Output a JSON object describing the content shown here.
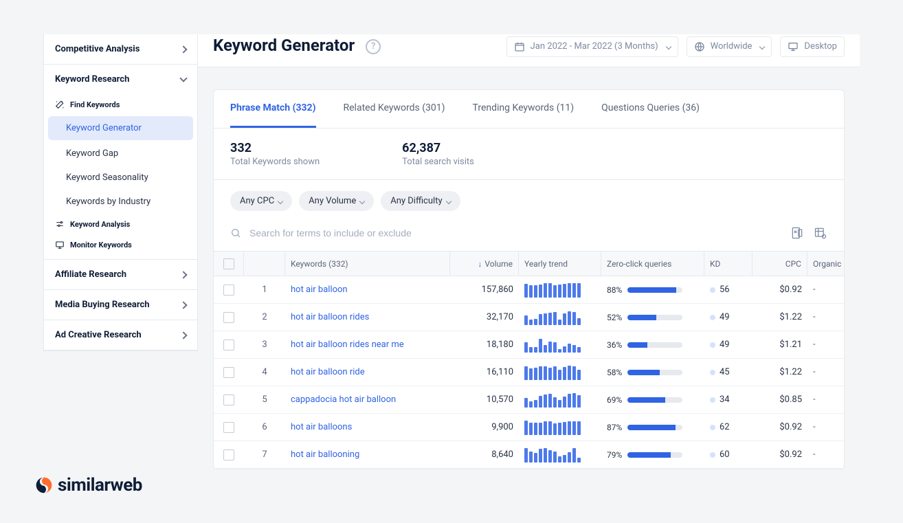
{
  "page_title": "Keyword Generator",
  "topbar": {
    "date_range": "Jan 2022 - Mar 2022 (3 Months)",
    "scope": "Worldwide",
    "device": "Desktop"
  },
  "sidebar": {
    "sections": [
      {
        "label": "Competitive Analysis"
      },
      {
        "label": "Keyword Research"
      }
    ],
    "group_find": "Find Keywords",
    "find_items": [
      {
        "label": "Keyword Generator",
        "active": true
      },
      {
        "label": "Keyword Gap"
      },
      {
        "label": "Keyword Seasonality"
      },
      {
        "label": "Keywords by Industry"
      }
    ],
    "group_analysis": "Keyword Analysis",
    "group_monitor": "Monitor Keywords",
    "bottom_sections": [
      {
        "label": "Affiliate Research"
      },
      {
        "label": "Media Buying Research"
      },
      {
        "label": "Ad Creative Research"
      }
    ]
  },
  "tabs": [
    {
      "label": "Phrase Match (332)",
      "active": true
    },
    {
      "label": "Related Keywords (301)"
    },
    {
      "label": "Trending Keywords (11)"
    },
    {
      "label": "Questions Queries (36)"
    }
  ],
  "stats": {
    "total_keywords": {
      "value": "332",
      "label": "Total Keywords shown"
    },
    "total_visits": {
      "value": "62,387",
      "label": "Total search visits"
    }
  },
  "filters": [
    "Any CPC",
    "Any Volume",
    "Any Difficulty"
  ],
  "search_placeholder": "Search for terms to include or exclude",
  "columns": {
    "keywords": "Keywords (332)",
    "volume": "Volume",
    "trend": "Yearly trend",
    "zeroclick": "Zero-click queries",
    "kd": "KD",
    "cpc": "CPC",
    "organic": "Organic"
  },
  "rows": [
    {
      "idx": 1,
      "kw": "hot air balloon",
      "vol": "157,860",
      "trend": [
        90,
        80,
        80,
        85,
        95,
        95,
        80,
        85,
        90,
        95,
        95,
        95
      ],
      "zc_pct": 88,
      "kd": 56,
      "cpc": "$0.92",
      "org": "-"
    },
    {
      "idx": 2,
      "kw": "hot air balloon rides",
      "vol": "32,170",
      "trend": [
        60,
        35,
        40,
        70,
        75,
        80,
        85,
        35,
        75,
        90,
        85,
        45
      ],
      "zc_pct": 52,
      "kd": 49,
      "cpc": "$1.22",
      "org": "-"
    },
    {
      "idx": 3,
      "kw": "hot air balloon rides near me",
      "vol": "18,180",
      "trend": [
        65,
        35,
        35,
        90,
        50,
        70,
        65,
        20,
        40,
        55,
        50,
        35
      ],
      "zc_pct": 36,
      "kd": 49,
      "cpc": "$1.21",
      "org": "-"
    },
    {
      "idx": 4,
      "kw": "hot air balloon ride",
      "vol": "16,110",
      "trend": [
        90,
        75,
        80,
        90,
        90,
        80,
        90,
        65,
        85,
        95,
        90,
        65
      ],
      "zc_pct": 58,
      "kd": 45,
      "cpc": "$1.22",
      "org": "-"
    },
    {
      "idx": 5,
      "kw": "cappadocia hot air balloon",
      "vol": "10,570",
      "trend": [
        60,
        40,
        50,
        75,
        85,
        90,
        65,
        50,
        70,
        90,
        95,
        80
      ],
      "zc_pct": 69,
      "kd": 34,
      "cpc": "$0.85",
      "org": "-"
    },
    {
      "idx": 6,
      "kw": "hot air balloons",
      "vol": "9,900",
      "trend": [
        95,
        80,
        80,
        80,
        90,
        90,
        75,
        80,
        85,
        90,
        90,
        90
      ],
      "zc_pct": 87,
      "kd": 62,
      "cpc": "$0.92",
      "org": "-"
    },
    {
      "idx": 7,
      "kw": "hot air ballooning",
      "vol": "8,640",
      "trend": [
        95,
        70,
        60,
        90,
        95,
        80,
        70,
        40,
        50,
        65,
        95,
        30
      ],
      "zc_pct": 79,
      "kd": 60,
      "cpc": "$0.92",
      "org": "-"
    }
  ],
  "brand": "similarweb"
}
